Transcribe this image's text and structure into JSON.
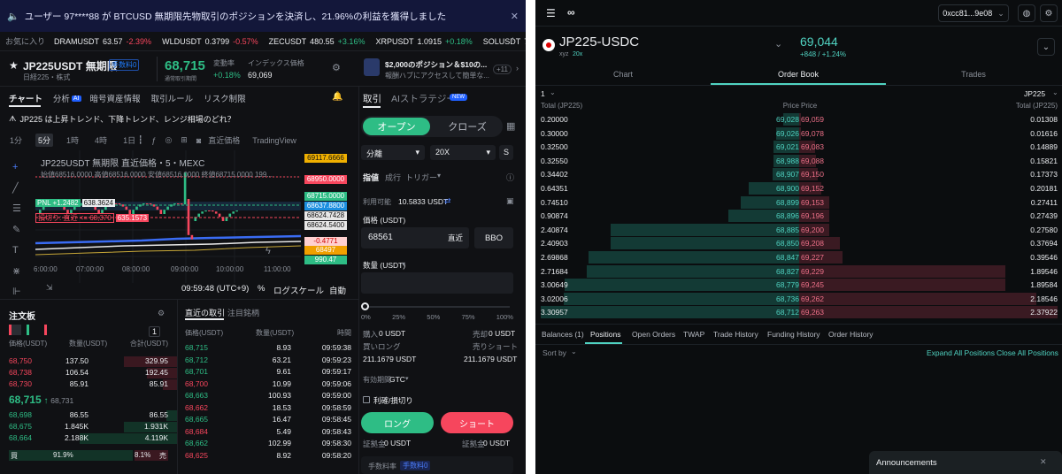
{
  "left": {
    "announcement": "ユーザー 97****88 が BTCUSD 無期限先物取引のポジションを決済し、21.96%の利益を獲得しました",
    "favorites_label": "お気に入り",
    "ticker": [
      {
        "sym": "DRAMUSDT",
        "price": "63.57",
        "chg": "-2.39%",
        "dir": "down"
      },
      {
        "sym": "WLDUSDT",
        "price": "0.3799",
        "chg": "-0.57%",
        "dir": "down"
      },
      {
        "sym": "ZECUSDT",
        "price": "480.55",
        "chg": "+3.16%",
        "dir": "up"
      },
      {
        "sym": "XRPUSDT",
        "price": "1.0915",
        "chg": "+0.18%",
        "dir": "up"
      },
      {
        "sym": "SOLUSDT",
        "price": "78.04",
        "chg": "+0",
        "dir": "up"
      }
    ],
    "symbol": "JP225USDT 無期限",
    "fee_badge": "手数料0",
    "sub": "日経225・株式",
    "price": "68,715",
    "price_sub": "通常取引期間",
    "chg_label": "変動率",
    "chg_val": "+0.18%",
    "idx_label": "インデックス価格",
    "idx_val": "69,069",
    "promo_line1": "$2,000のポジション＆$10の...",
    "promo_line2": "報酬ハブにアクセスして簡単な...",
    "promo_count": "+11",
    "chart_tabs": [
      "チャート",
      "分析",
      "暗号資産情報",
      "取引ルール",
      "リスク制限"
    ],
    "ai_badge": "AI",
    "insight": "JP225 は上昇トレンド、下降トレンド、レンジ相場のどれ？",
    "intervals": [
      "1分",
      "5分",
      "1時",
      "4時",
      "1日"
    ],
    "price_type": "直近価格",
    "tv_label": "TradingView",
    "chart_title": "JP225USDT 無期限 直近価格・5・MEXC",
    "ohlc": "始値68516.0000 高値68516.0000 安値68516.0000 終値68715.0000 199...",
    "pnl_label": "PNL +1.2482",
    "pnl_price": "638.3624",
    "sl_label": "損切り: 直近 <= 68,370",
    "sl_price": "635.1573",
    "chart_prices": [
      "69117.6666",
      "68950.0000",
      "68715.0000",
      "68637.8800",
      "68624.7428",
      "68624.5400",
      "-0.4771",
      "68497",
      "990.47"
    ],
    "chart_times": [
      "6:00:00",
      "07:00:00",
      "08:00:00",
      "09:00:00",
      "10:00:00",
      "11:00:00"
    ],
    "clock": "09:59:48 (UTC+9)",
    "pct": "%",
    "log_scale": "ログスケール",
    "auto": "自動",
    "ob": {
      "title": "注文板",
      "step": "1",
      "headers": [
        "価格(USDT)",
        "数量(USDT)",
        "合計(USDT)"
      ],
      "asks": [
        [
          "68,750",
          "137.50",
          "329.95"
        ],
        [
          "68,738",
          "106.54",
          "192.45"
        ],
        [
          "68,730",
          "85.91",
          "85.91"
        ]
      ],
      "mid": "68,715",
      "mid_arrow": "↑",
      "mid_ref": "68,731",
      "bids": [
        [
          "68,698",
          "86.55",
          "86.55"
        ],
        [
          "68,675",
          "1.845K",
          "1.931K"
        ],
        [
          "68,664",
          "2.188K",
          "4.119K"
        ]
      ],
      "buy_label": "買",
      "buy_pct": "91.9%",
      "sell_pct": "8.1%",
      "sell_label": "売"
    },
    "trades": {
      "tabs": [
        "直近の取引",
        "注目銘柄"
      ],
      "headers": [
        "価格(USDT)",
        "数量(USDT)",
        "時間"
      ],
      "rows": [
        [
          "68,715",
          "8.93",
          "09:59:38",
          "up"
        ],
        [
          "68,712",
          "63.21",
          "09:59:23",
          "up"
        ],
        [
          "68,701",
          "9.61",
          "09:59:17",
          "up"
        ],
        [
          "68,700",
          "10.99",
          "09:59:06",
          "down"
        ],
        [
          "68,663",
          "100.93",
          "09:59:00",
          "up"
        ],
        [
          "68,662",
          "18.53",
          "09:58:59",
          "down"
        ],
        [
          "68,665",
          "16.47",
          "09:58:45",
          "up"
        ],
        [
          "68,684",
          "5.49",
          "09:58:43",
          "down"
        ],
        [
          "68,662",
          "102.99",
          "09:58:30",
          "up"
        ],
        [
          "68,625",
          "8.92",
          "09:58:20",
          "down"
        ]
      ]
    },
    "trade": {
      "tabs": [
        "取引",
        "AIストラテジー"
      ],
      "new_badge": "NEW",
      "open": "オープン",
      "close": "クローズ",
      "margin": "分離",
      "leverage": "20X",
      "mode": "S",
      "order_tabs": [
        "指値",
        "成行",
        "トリガー"
      ],
      "avail_label": "利用可能",
      "avail_val": "10.5833 USDT",
      "price_label": "価格 (USDT)",
      "price_val": "68561",
      "last_btn": "直近",
      "bbo": "BBO",
      "qty_label": "数量 (USDT)",
      "slider_marks": [
        "0%",
        "25%",
        "50%",
        "75%",
        "100%"
      ],
      "buy_amt_label": "購入",
      "buy_amt": "0 USDT",
      "sell_amt_label": "売却",
      "sell_amt": "0 USDT",
      "long_label": "買いロング",
      "short_label": "売りショート",
      "long_val": "211.1679 USDT",
      "short_val": "211.1679 USDT",
      "tif_label": "有効期間",
      "tif": "GTC",
      "tpsl": "利確/損切り",
      "long_btn": "ロング",
      "short_btn": "ショート",
      "margin_l": "証拠金",
      "margin_lv": "0 USDT",
      "margin_r": "証拠金",
      "margin_rv": "0 USDT",
      "fee_label": "手数料率",
      "fee_badge": "手数料0"
    }
  },
  "right": {
    "wallet": "0xcc81...9e08",
    "market": "JP225-USDC",
    "market_sub": "xyz",
    "market_lev": "20x",
    "price": "69,044",
    "price_chg": "+848 / +1.24%",
    "tabs": [
      "Chart",
      "Order Book",
      "Trades"
    ],
    "step": "1",
    "unit": "JP225",
    "headers": [
      "Total (JP225)",
      "Price",
      "Price",
      "Total (JP225)"
    ],
    "rows": [
      [
        "0.20000",
        "69,028",
        "69,059",
        "0.01308"
      ],
      [
        "0.30000",
        "69,026",
        "69,078",
        "0.01616"
      ],
      [
        "0.32500",
        "69,021",
        "69,083",
        "0.14889"
      ],
      [
        "0.32550",
        "68,988",
        "69,088",
        "0.15821"
      ],
      [
        "0.34402",
        "68,907",
        "69,150",
        "0.17373"
      ],
      [
        "0.64351",
        "68,900",
        "69,152",
        "0.20181"
      ],
      [
        "0.74510",
        "68,899",
        "69,153",
        "0.27411"
      ],
      [
        "0.90874",
        "68,896",
        "69,196",
        "0.27439"
      ],
      [
        "2.40874",
        "68,885",
        "69,200",
        "0.27580"
      ],
      [
        "2.40903",
        "68,850",
        "69,208",
        "0.37694"
      ],
      [
        "2.69868",
        "68,847",
        "69,227",
        "0.39546"
      ],
      [
        "2.71684",
        "68,827",
        "69,229",
        "1.89546"
      ],
      [
        "3.00649",
        "68,779",
        "69,245",
        "1.89584"
      ],
      [
        "3.02006",
        "68,736",
        "69,262",
        "2.18546"
      ],
      [
        "3.30957",
        "68,712",
        "69,263",
        "2.37922"
      ]
    ],
    "bottom_tabs": [
      "Balances (1)",
      "Positions",
      "Open Orders",
      "TWAP",
      "Trade History",
      "Funding History",
      "Order History"
    ],
    "sort": "Sort by",
    "expand": "Expand All Positions",
    "close_all": "Close All Positions",
    "announcements": "Announcements"
  },
  "colors": {
    "green": "#2ebd85",
    "red": "#f6465d",
    "hl_green": "#50d2c1",
    "hl_red": "#ed7088"
  }
}
